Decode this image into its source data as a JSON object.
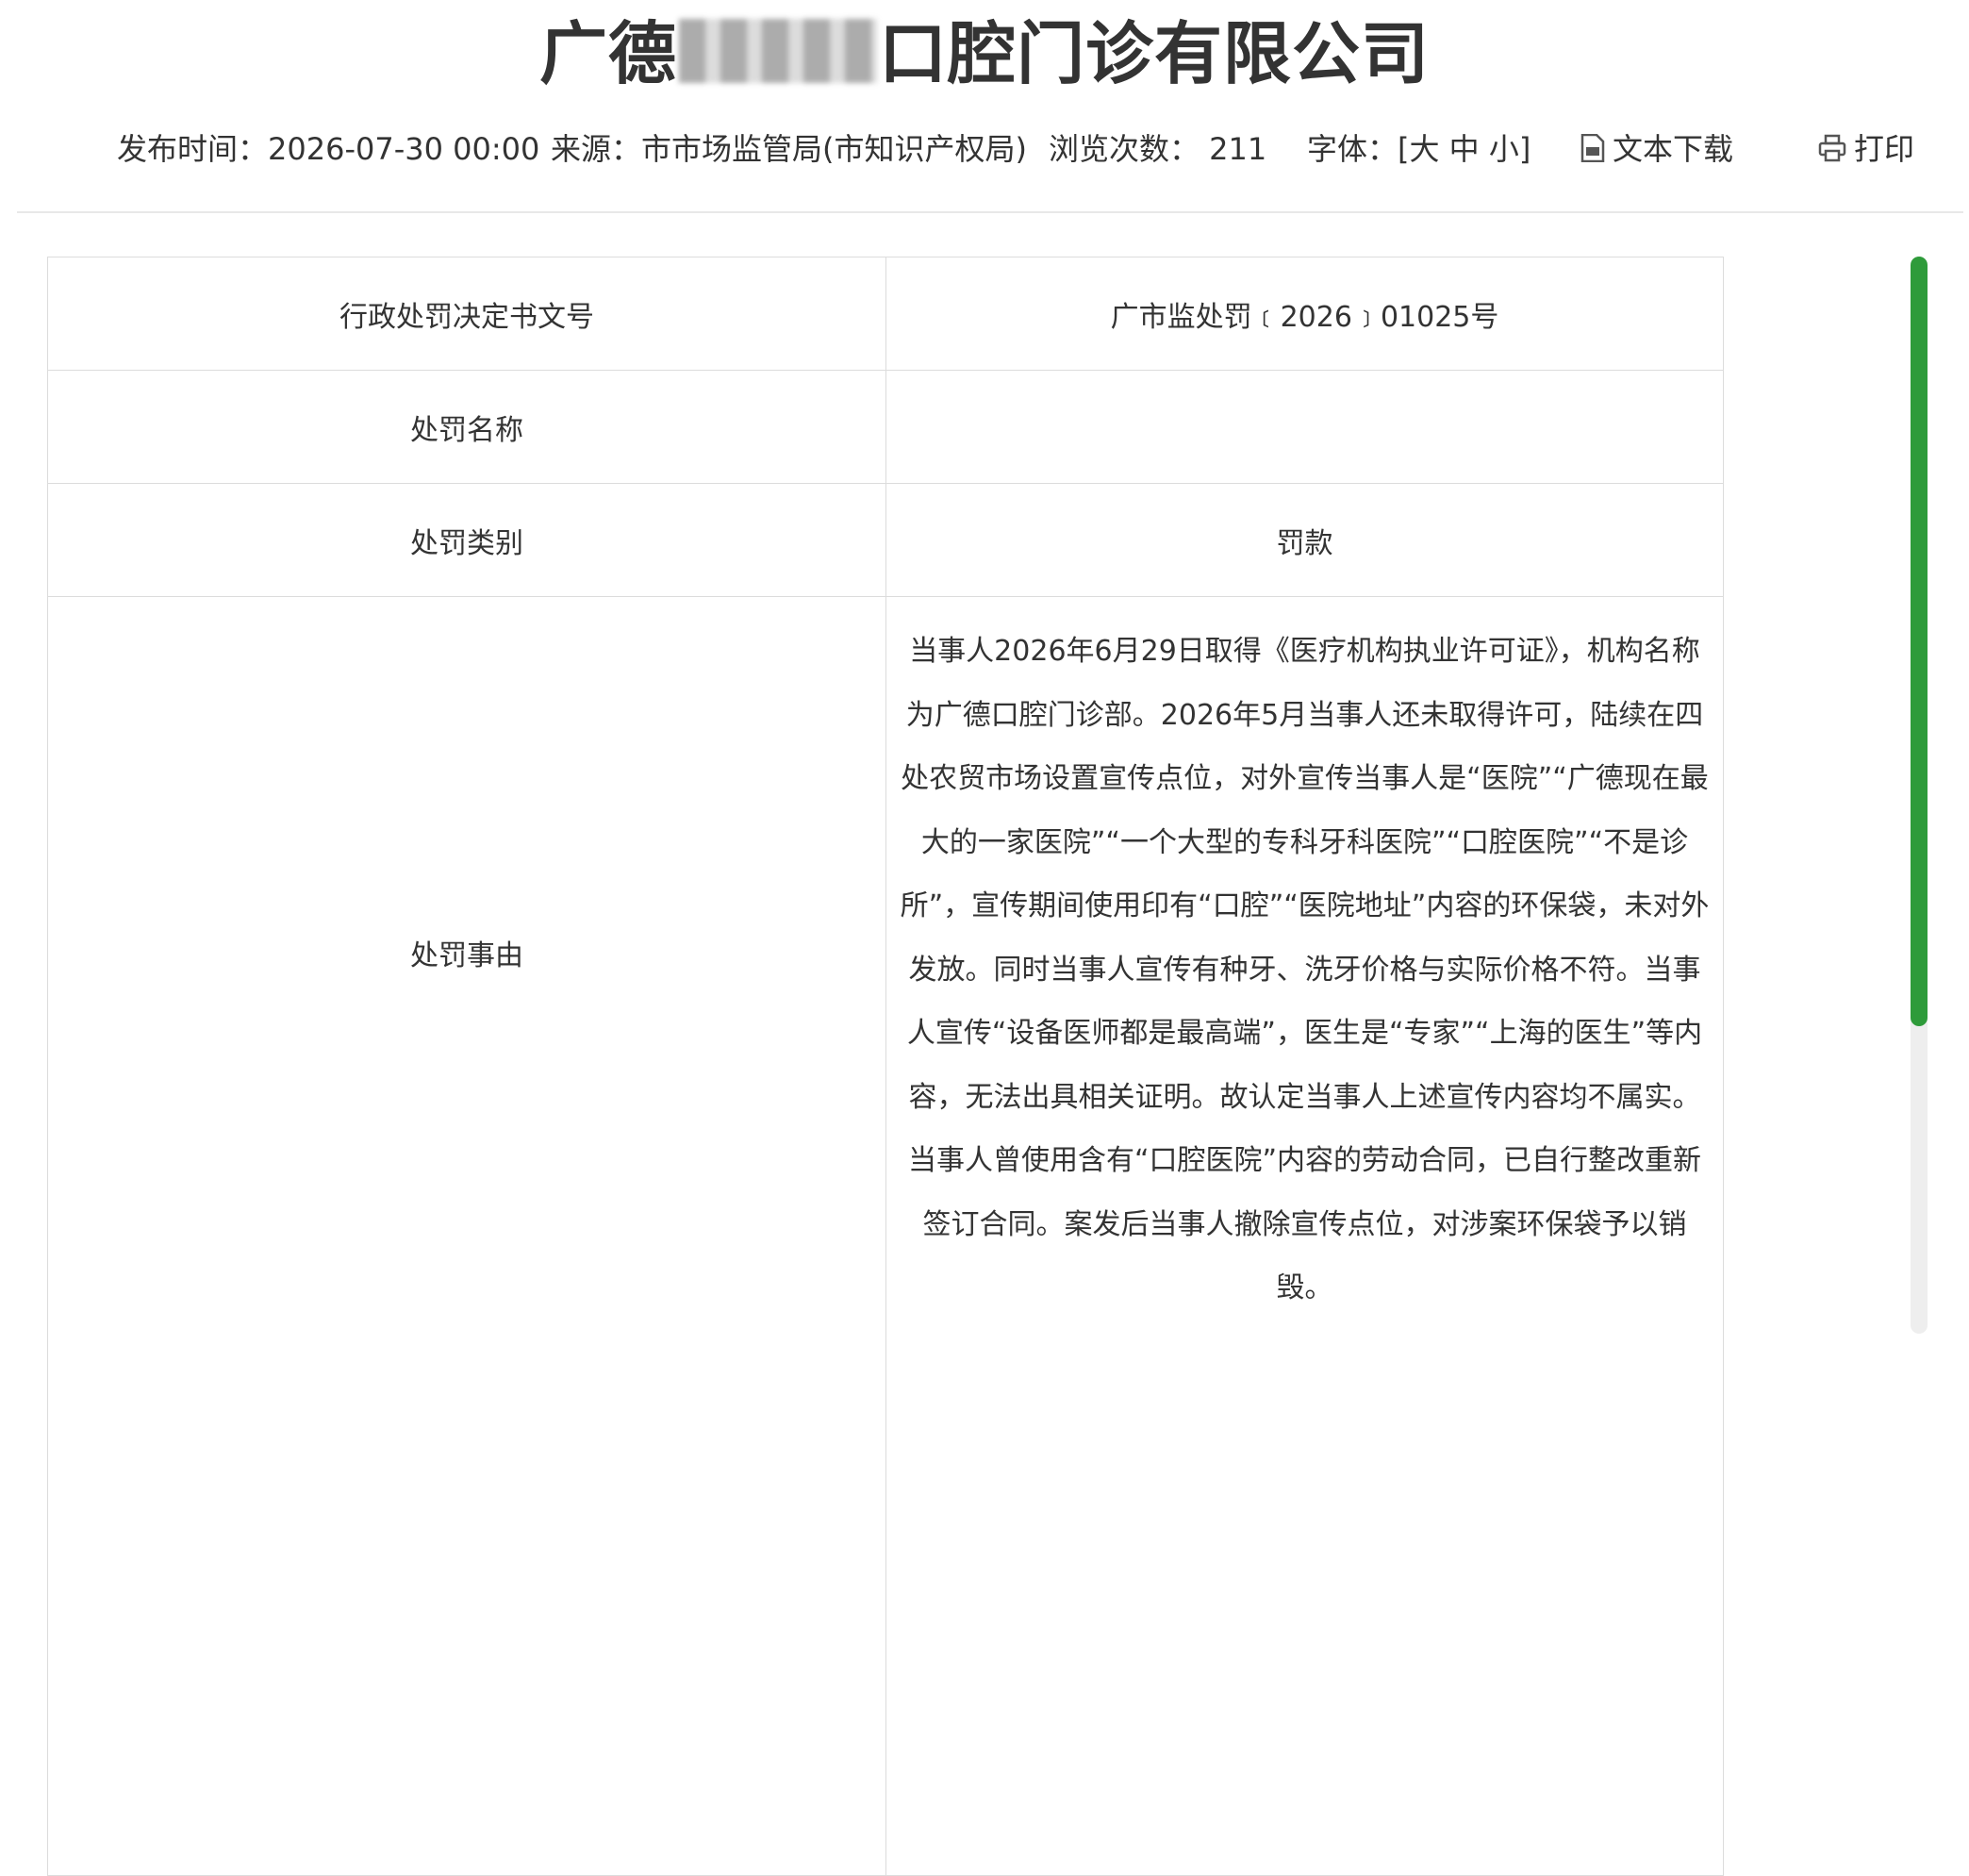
{
  "header": {
    "title_prefix": "广德",
    "title_suffix": "口腔门诊有限公司"
  },
  "meta": {
    "publish_time": "发布时间：2026-07-30 00:00",
    "source": "来源：市市场监管局(市知识产权局)",
    "views": "浏览次数：  211",
    "font_size": "字体：[大 中 小]",
    "download_label": "文本下载",
    "print_label": "打印"
  },
  "table": {
    "rows": [
      {
        "key": "行政处罚决定书文号",
        "value": "广市监处罚﹝2026﹞01025号"
      },
      {
        "key": "处罚名称",
        "value": ""
      },
      {
        "key": "处罚类别",
        "value": "罚款"
      },
      {
        "key": "处罚事由",
        "value": "当事人2026年6月29日取得《医疗机构执业许可证》，机构名称为广德口腔门诊部。2026年5月当事人还未取得许可，陆续在四处农贸市场设置宣传点位，对外宣传当事人是“医院”“广德现在最大的一家医院”“一个大型的专科牙科医院”“口腔医院”“不是诊所”，宣传期间使用印有“口腔”“医院地址”内容的环保袋，未对外发放。同时当事人宣传有种牙、洗牙价格与实际价格不符。当事人宣传“设备医师都是最高端”，医生是“专家”“上海的医生”等内容，无法出具相关证明。故认定当事人上述宣传内容均不属实。当事人曾使用含有“口腔医院”内容的劳动合同，已自行整改重新签订合同。案发后当事人撤除宣传点位，对涉案环保袋予以销毁。"
      }
    ]
  },
  "colors": {
    "scroll_thumb": "#2e9b3a",
    "text": "#333333",
    "border": "#dcdcdc"
  }
}
